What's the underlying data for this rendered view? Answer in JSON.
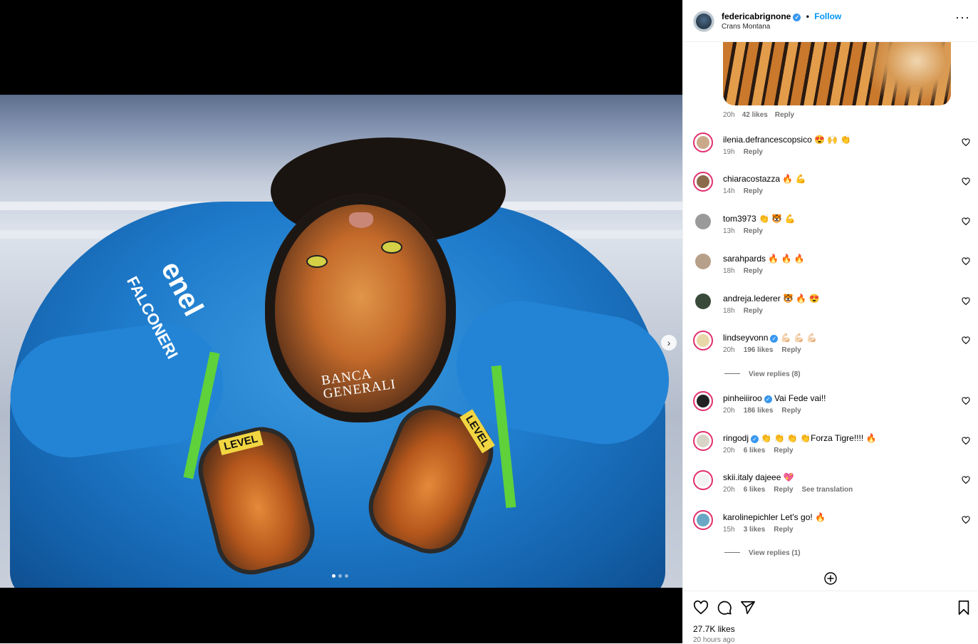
{
  "post": {
    "author": "federicabrignone",
    "separator": "•",
    "follow_label": "Follow",
    "location": "Crans Montana",
    "more_label": "···"
  },
  "media": {
    "helmet_text_1": "BANCA",
    "helmet_text_2": "GENERALI",
    "sponsor_left": "enel",
    "sponsor_left_2": "FALCONERI",
    "mitt_label": "LEVEL",
    "carousel_count": 3,
    "carousel_active": 1
  },
  "top_comment_meta": {
    "time": "20h",
    "likes": "42 likes",
    "reply": "Reply"
  },
  "comments": [
    {
      "user": "ilenia.defrancescopsico",
      "verified": false,
      "text": " 😍 🙌 👏",
      "time": "19h",
      "likes": "",
      "reply": "Reply",
      "extra": "",
      "color": "#c9a98a"
    },
    {
      "user": "chiaracostazza",
      "verified": false,
      "text": " 🔥 💪",
      "time": "14h",
      "likes": "",
      "reply": "Reply",
      "extra": "",
      "color": "#8a6a4a"
    },
    {
      "user": "tom3973",
      "verified": false,
      "text": " 👏 🐯 💪",
      "time": "13h",
      "likes": "",
      "reply": "Reply",
      "extra": "",
      "color": "#9a9a9a"
    },
    {
      "user": "sarahpards",
      "verified": false,
      "text": " 🔥 🔥 🔥",
      "time": "18h",
      "likes": "",
      "reply": "Reply",
      "extra": "",
      "color": "#b7a08a"
    },
    {
      "user": "andreja.lederer",
      "verified": false,
      "text": " 🐯 🔥 😍",
      "time": "18h",
      "likes": "",
      "reply": "Reply",
      "extra": "",
      "color": "#3a4a3a"
    },
    {
      "user": "lindseyvonn",
      "verified": true,
      "text": " 💪🏻 💪🏻 💪🏻",
      "time": "20h",
      "likes": "196 likes",
      "reply": "Reply",
      "extra": "",
      "color": "#e8d7a8"
    },
    {
      "user": "pinheiiiroo",
      "verified": true,
      "text": " Vai Fede vai!!",
      "time": "20h",
      "likes": "186 likes",
      "reply": "Reply",
      "extra": "",
      "color": "#222222"
    },
    {
      "user": "ringodj",
      "verified": true,
      "text": " 👏 👏 👏 👏Forza Tigre!!!! 🔥",
      "time": "20h",
      "likes": "6 likes",
      "reply": "Reply",
      "extra": "",
      "color": "#d9d4c8"
    },
    {
      "user": "skii.italy",
      "verified": false,
      "text": " dajeee 💖",
      "time": "20h",
      "likes": "6 likes",
      "reply": "Reply",
      "extra": "See translation",
      "color": "#f2f2f2"
    },
    {
      "user": "karolinepichler",
      "verified": false,
      "text": " Let's go! 🔥",
      "time": "15h",
      "likes": "3 likes",
      "reply": "Reply",
      "extra": "",
      "color": "#6aa7c4"
    }
  ],
  "view_replies": [
    {
      "label": "View replies (8)"
    },
    {
      "label": "View replies (1)"
    }
  ],
  "footer": {
    "likes": "27.7K likes",
    "time": "20 hours ago"
  }
}
